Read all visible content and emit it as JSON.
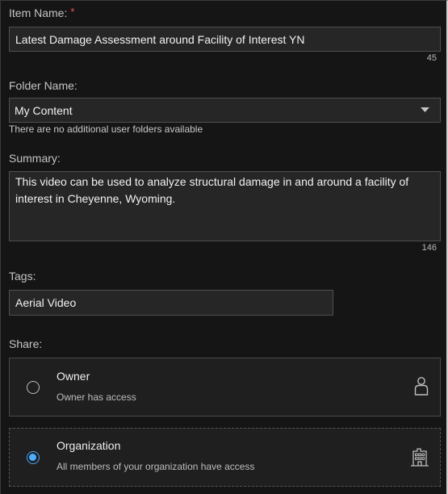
{
  "item_name": {
    "label": "Item Name:",
    "required_marker": "*",
    "value": "Latest Damage Assessment around Facility of Interest YN",
    "char_count": "45"
  },
  "folder_name": {
    "label": "Folder Name:",
    "selected": "My Content",
    "hint": "There are no additional user folders available"
  },
  "summary": {
    "label": "Summary:",
    "value": "This video can be used to analyze structural damage in and around a facility of interest in Cheyenne, Wyoming.",
    "char_count": "146"
  },
  "tags": {
    "label": "Tags:",
    "value": "Aerial Video"
  },
  "share": {
    "label": "Share:",
    "options": [
      {
        "title": "Owner",
        "description": "Owner has access",
        "selected": false,
        "icon": "user-icon"
      },
      {
        "title": "Organization",
        "description": "All members of your organization have access",
        "selected": true,
        "icon": "building-icon"
      }
    ]
  },
  "colors": {
    "accent": "#4ab0ff",
    "required": "#e8535a",
    "background": "#151515",
    "input_bg": "#262626"
  }
}
